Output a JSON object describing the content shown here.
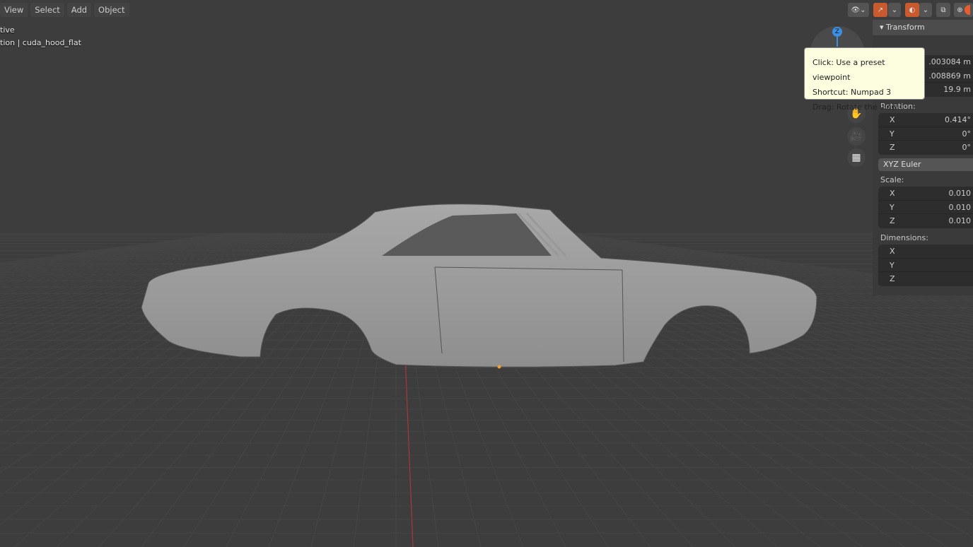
{
  "menu": [
    "View",
    "Select",
    "Add",
    "Object"
  ],
  "overlay": {
    "line1": "tive",
    "line2": "tion | cuda_hood_flat"
  },
  "gizmo": {
    "axis": "Z"
  },
  "tooltip": {
    "line1": "Click: Use a preset viewpoint",
    "line2": "Shortcut: Numpad 3",
    "line3": "Drag: Rotate the view"
  },
  "panel": {
    "title": "Transform",
    "location_values": [
      ".003084 m",
      ".008869 m",
      "19.9 m"
    ],
    "rotation_label": "Rotation:",
    "rotation": [
      {
        "axis": "X",
        "value": "0.414°"
      },
      {
        "axis": "Y",
        "value": "0°"
      },
      {
        "axis": "Z",
        "value": "0°"
      }
    ],
    "rotation_mode": "XYZ Euler",
    "scale_label": "Scale:",
    "scale": [
      {
        "axis": "X",
        "value": "0.010"
      },
      {
        "axis": "Y",
        "value": "0.010"
      },
      {
        "axis": "Z",
        "value": "0.010"
      }
    ],
    "dimensions_label": "Dimensions:",
    "dimensions": [
      {
        "axis": "X"
      },
      {
        "axis": "Y"
      },
      {
        "axis": "Z"
      }
    ]
  }
}
